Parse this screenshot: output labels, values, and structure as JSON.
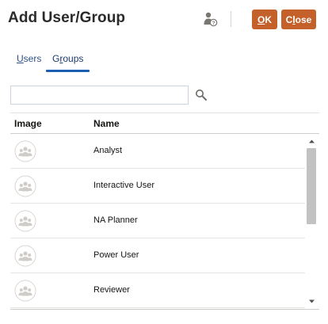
{
  "dialog": {
    "title": "Add User/Group",
    "ok_label_underlined": "O",
    "ok_label_rest": "K",
    "close_label_first": "C",
    "close_label_underlined": "l",
    "close_label_rest": "ose",
    "accent_color": "#c4602a"
  },
  "tabs": {
    "users_underlined": "U",
    "users_rest": "sers",
    "groups_first": "G",
    "groups_underlined": "r",
    "groups_rest": "oups",
    "selected": "Groups"
  },
  "search": {
    "value": "",
    "icon": "search-icon"
  },
  "table": {
    "columns": [
      "Image",
      "Name"
    ],
    "rows": [
      {
        "name": "Analyst",
        "icon": "group-avatar-icon"
      },
      {
        "name": "Interactive User",
        "icon": "group-avatar-icon"
      },
      {
        "name": "NA Planner",
        "icon": "group-avatar-icon"
      },
      {
        "name": "Power User",
        "icon": "group-avatar-icon"
      },
      {
        "name": "Reviewer",
        "icon": "group-avatar-icon"
      }
    ]
  }
}
